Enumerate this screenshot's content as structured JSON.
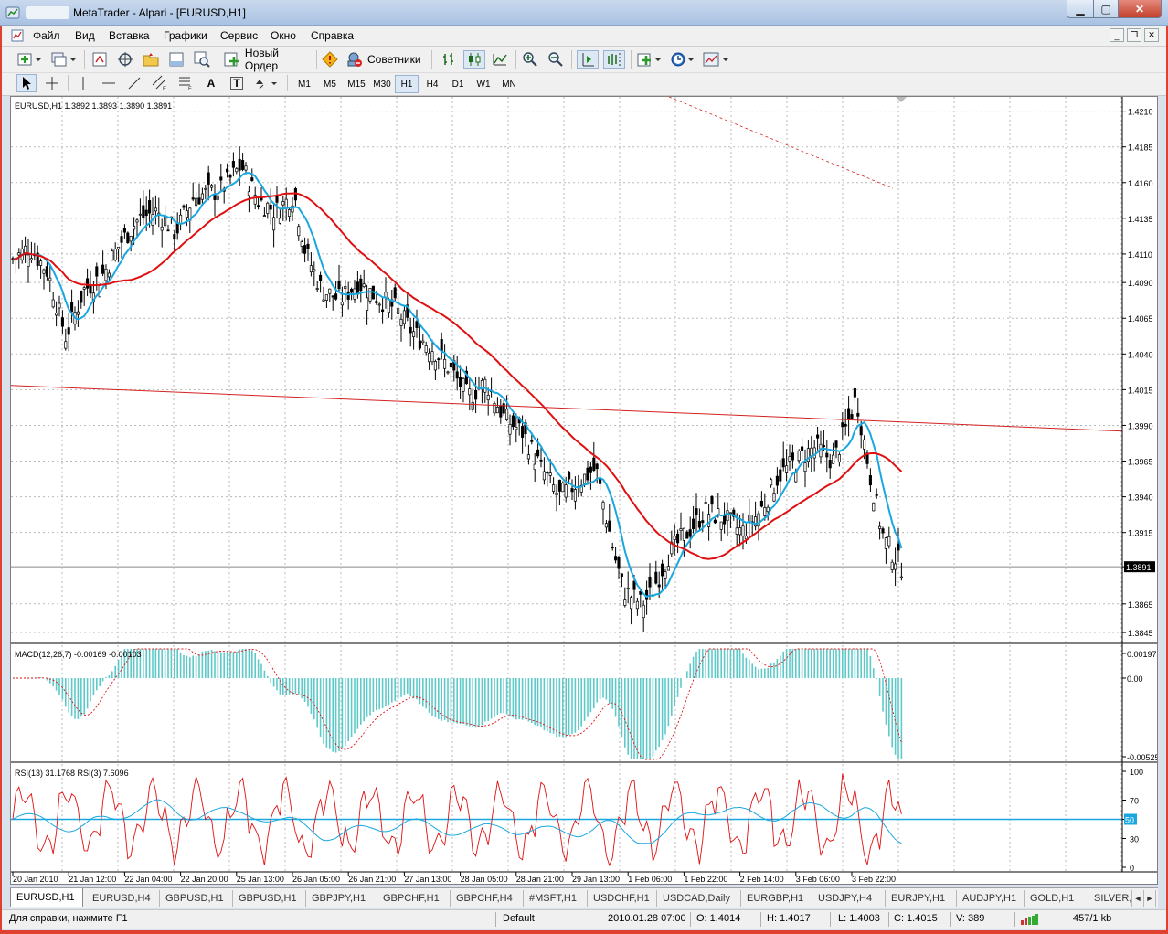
{
  "window": {
    "title": "MetaTrader - Alpari - [EURUSD,H1]",
    "min_glyph": "▁",
    "max_glyph": "▢",
    "close_glyph": "✕"
  },
  "menu": [
    "Файл",
    "Вид",
    "Вставка",
    "Графики",
    "Сервис",
    "Окно",
    "Справка"
  ],
  "mdi": {
    "min": "_",
    "restore": "❐",
    "close": "✕"
  },
  "toolbar": {
    "new_order": "Новый Ордер",
    "experts": "Советники"
  },
  "timeframes": [
    "M1",
    "M5",
    "M15",
    "M30",
    "H1",
    "H4",
    "D1",
    "W1",
    "MN"
  ],
  "active_timeframe": "H1",
  "drawing_tools": {
    "text_tool": "A",
    "label_tool": "T"
  },
  "chart": {
    "info": "EURUSD,H1  1.3892 1.3893 1.3890 1.3891",
    "price_ticks": [
      "1.4210",
      "1.4185",
      "1.4160",
      "1.4135",
      "1.4110",
      "1.4090",
      "1.4065",
      "1.4040",
      "1.4015",
      "1.3990",
      "1.3965",
      "1.3940",
      "1.3915",
      "1.3891",
      "1.3865",
      "1.3845"
    ],
    "current_price": "1.3891",
    "time_labels": [
      "20 Jan 2010",
      "21 Jan 12:00",
      "22 Jan 04:00",
      "22 Jan 20:00",
      "25 Jan 13:00",
      "26 Jan 05:00",
      "26 Jan 21:00",
      "27 Jan 13:00",
      "28 Jan 05:00",
      "28 Jan 21:00",
      "29 Jan 13:00",
      "1 Feb 06:00",
      "1 Feb 22:00",
      "2 Feb 14:00",
      "3 Feb 06:00",
      "3 Feb 22:00"
    ],
    "macd": {
      "label": "MACD(12,26,7) -0.00169 -0.00103",
      "ticks": [
        "0.00197",
        "0.00",
        "-0.00525"
      ]
    },
    "rsi": {
      "label": "RSI(13) 31.1768  RSI(3) 7.6096",
      "ticks": [
        "100",
        "70",
        "50",
        "30",
        "0"
      ],
      "level_label": "50"
    },
    "colors": {
      "bull_bear": "#000000",
      "ma_fast": "#1aa7e0",
      "ma_slow": "#e01010",
      "trendline": "#d22222",
      "macd_hist": "#5fc9c9",
      "rsi_slow": "#1aa7e0",
      "rsi_fast": "#e01010"
    }
  },
  "tabs": [
    "EURUSD,H1",
    "EURUSD,H4",
    "GBPUSD,H1",
    "GBPUSD,H1",
    "GBPJPY,H1",
    "GBPCHF,H1",
    "GBPCHF,H4",
    "#MSFT,H1",
    "USDCHF,H1",
    "USDCAD,Daily",
    "EURGBP,H1",
    "USDJPY,H4",
    "EURJPY,H1",
    "AUDJPY,H1",
    "GOLD,H1",
    "SILVER,"
  ],
  "active_tab": "EURUSD,H1",
  "status": {
    "help": "Для справки, нажмите F1",
    "profile": "Default",
    "datetime": "2010.01.28 07:00",
    "open": "O: 1.4014",
    "high": "H: 1.4017",
    "low": "L: 1.4003",
    "close": "C: 1.4015",
    "volume": "V: 389",
    "traffic": "457/1 kb"
  }
}
